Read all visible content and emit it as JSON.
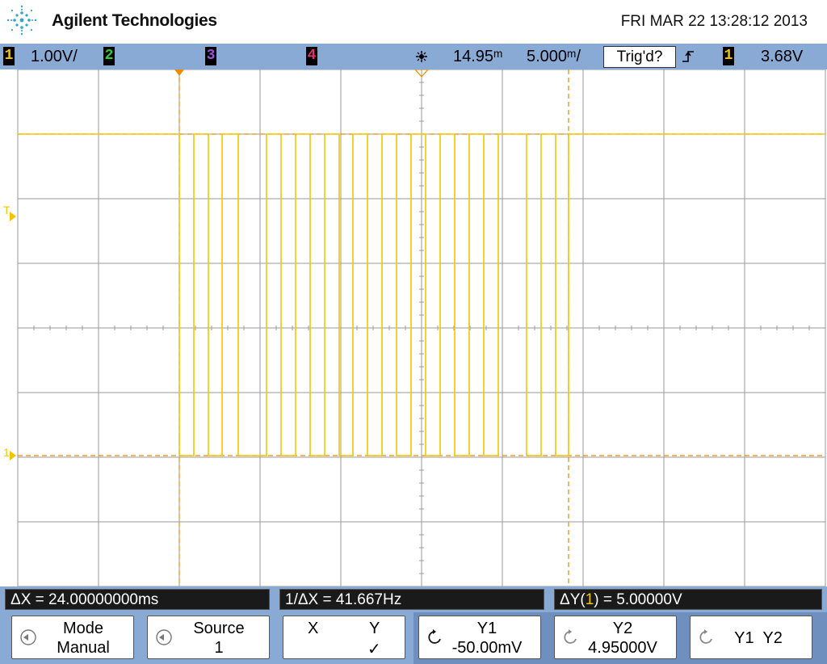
{
  "header": {
    "brand": "Agilent Technologies",
    "datetime": "FRI MAR 22 13:28:12 2013"
  },
  "status": {
    "ch1_label": "1",
    "ch1_scale": "1.00V/",
    "ch2_label": "2",
    "ch3_label": "3",
    "ch4_label": "4",
    "time_delay": "14.95ᵐ",
    "time_delay_unit": "s",
    "time_scale": "5.000ᵐ/",
    "trigger_status": "Trig'd?",
    "trigger_slope_icon": "rising-edge-icon",
    "trigger_channel": "1",
    "trigger_level": "3.68V",
    "colors": {
      "ch1": "#f5c400",
      "ch2": "#33cc33",
      "ch3": "#a050d8",
      "ch4": "#e83070",
      "cursor": "#f08a00"
    }
  },
  "screen": {
    "trigger_marker": "T",
    "ground_marker": "1"
  },
  "measurements": {
    "delta_x": "ΔX = 24.00000000ms",
    "inv_delta_x": "1/ΔX = 41.667Hz",
    "delta_y_prefix": "ΔY(",
    "delta_y_channel": "1",
    "delta_y_suffix": ") = 5.00000V"
  },
  "softkeys": {
    "mode_label": "Mode",
    "mode_value": "Manual",
    "source_label": "Source",
    "source_value": "1",
    "x_label": "X",
    "y_label": "Y",
    "y_check": "✓",
    "y1_label": "Y1",
    "y1_value": "-50.00mV",
    "y2_label": "Y2",
    "y2_value": "4.95000V",
    "y1y2_label": "Y1  Y2"
  }
}
